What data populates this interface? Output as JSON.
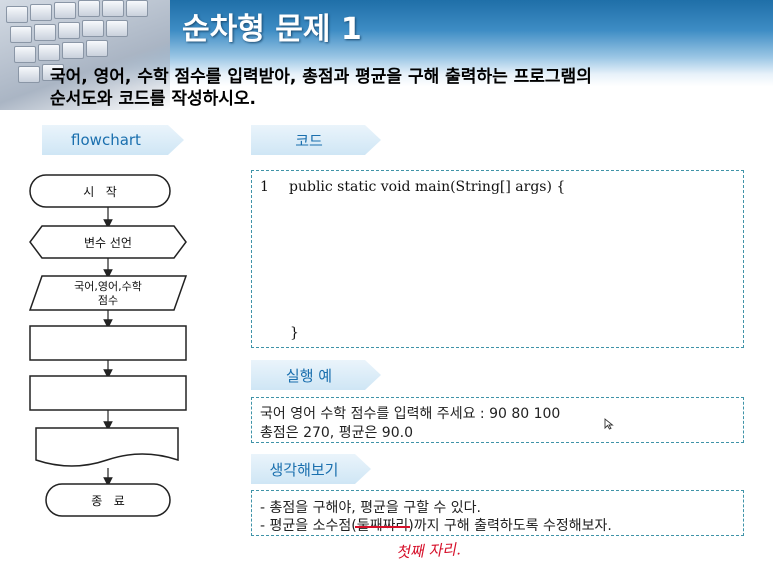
{
  "title": "순차형 문제 1",
  "question": {
    "line1": "국어, 영어, 수학 점수를 입력받아, 총점과 평균을 구해 출력하는 프로그램의",
    "line2": "순서도와 코드를 작성하시오."
  },
  "flowchart": {
    "tag": "flowchart",
    "start": "시   작",
    "declare": "변수 선언",
    "input_line1": "국어,영어,수학",
    "input_line2": "점수",
    "end": "종   료"
  },
  "code": {
    "tag": "코드",
    "line_number": "1",
    "line1": "public static void main(String[] args) {",
    "closing": "}"
  },
  "run": {
    "tag": "실행 예",
    "line1": "국어 영어 수학 점수를 입력해 주세요 : 90 80 100",
    "line2": "총점은 270, 평균은 90.0"
  },
  "think": {
    "tag": "생각해보기",
    "line1": "- 총점을 구해야, 평균을 구할 수 있다.",
    "line2_before": "- 평균을 소수점(",
    "line2_struck": "둘째짜리",
    "line2_after": ")까지 구해 출력하도록 수정해보자.",
    "handwriting": "첫째 자리."
  },
  "colors": {
    "accent": "#1a6fae",
    "border": "#3f93a8",
    "annotation": "#d6102a"
  }
}
